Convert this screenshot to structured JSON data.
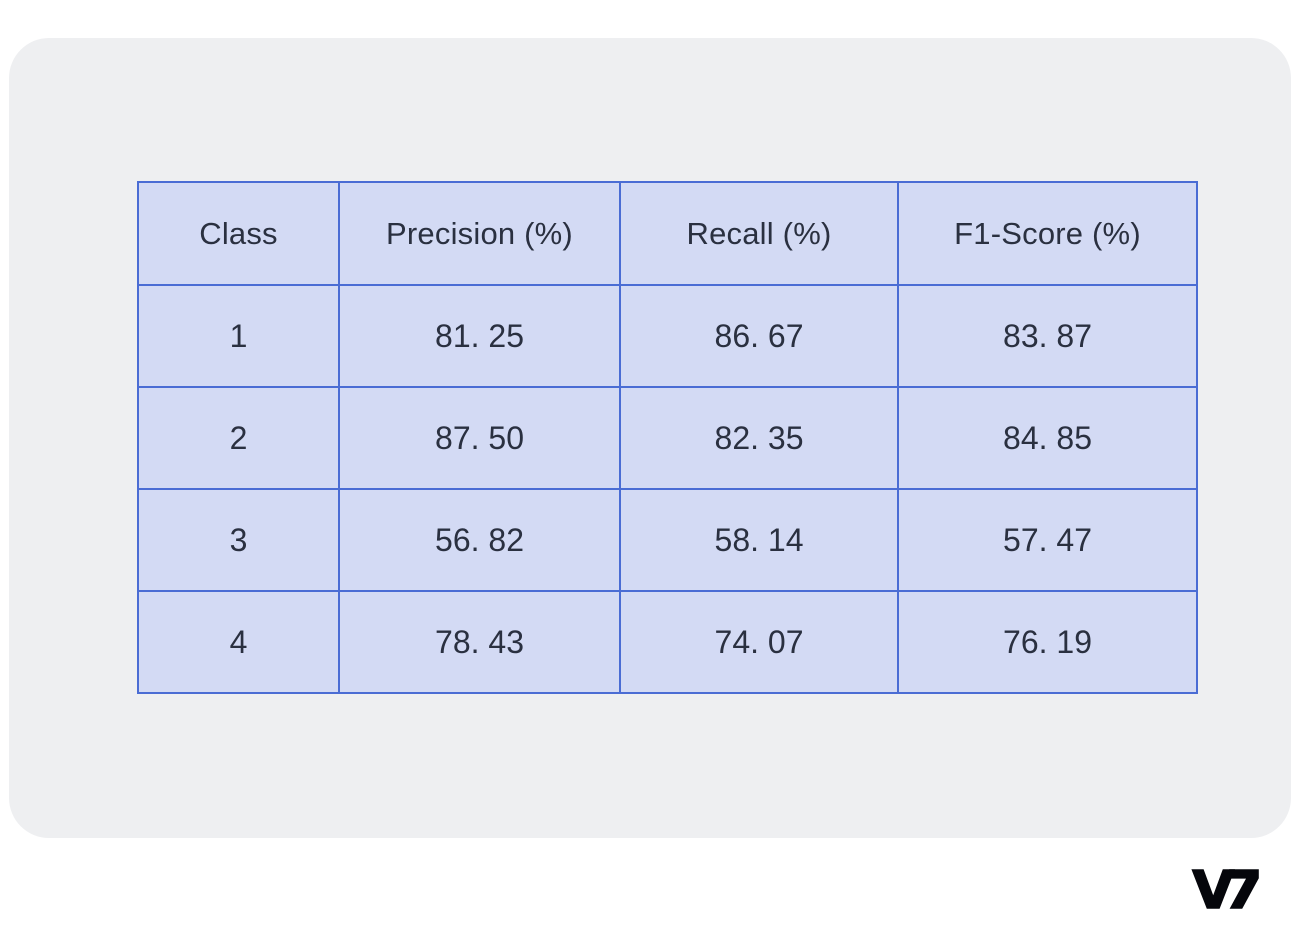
{
  "card": {
    "background_color": "#EEEFF1",
    "page_background_color": "#FFFFFF"
  },
  "table": {
    "border_color": "#4A6CD4",
    "cell_background_color": "#D3DAF4",
    "text_color": "#2A3040",
    "columns": [
      "Class",
      "Precision (%)",
      "Recall (%)",
      "F1-Score (%)"
    ],
    "rows": [
      {
        "class": "1",
        "precision": "81. 25",
        "recall": "86. 67",
        "f1": "83. 87"
      },
      {
        "class": "2",
        "precision": "87. 50",
        "recall": "82. 35",
        "f1": "84. 85"
      },
      {
        "class": "3",
        "precision": "56. 82",
        "recall": "58. 14",
        "f1": "57. 47"
      },
      {
        "class": "4",
        "precision": "78. 43",
        "recall": "74. 07",
        "f1": "76. 19"
      }
    ]
  },
  "branding": {
    "logo_text": "V7",
    "logo_icon": "v7-logo-icon",
    "logo_color": "#05060B"
  },
  "chart_data": {
    "type": "table",
    "title": "",
    "columns": [
      "Class",
      "Precision (%)",
      "Recall (%)",
      "F1-Score (%)"
    ],
    "rows": [
      [
        "1",
        81.25,
        86.67,
        83.87
      ],
      [
        "2",
        87.5,
        82.35,
        84.85
      ],
      [
        "3",
        56.82,
        58.14,
        57.47
      ],
      [
        "4",
        78.43,
        74.07,
        76.19
      ]
    ],
    "series": [
      {
        "name": "Precision (%)",
        "values": [
          81.25,
          87.5,
          56.82,
          78.43
        ]
      },
      {
        "name": "Recall (%)",
        "values": [
          86.67,
          82.35,
          58.14,
          74.07
        ]
      },
      {
        "name": "F1-Score (%)",
        "values": [
          83.87,
          84.85,
          57.47,
          76.19
        ]
      }
    ],
    "categories": [
      "1",
      "2",
      "3",
      "4"
    ],
    "xlabel": "Class",
    "ylabel": "",
    "grid": true,
    "legend": "none"
  }
}
